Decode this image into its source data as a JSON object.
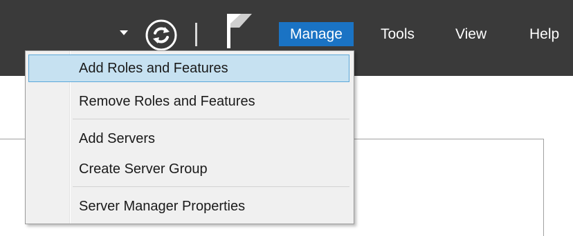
{
  "toolbar": {
    "icons": {
      "dropdown": "chevron-down-icon",
      "refresh": "refresh-icon",
      "notifications": "flag-icon"
    }
  },
  "menubar": {
    "manage": "Manage",
    "tools": "Tools",
    "view": "View",
    "help": "Help",
    "active_color": "#1a73c4"
  },
  "manage_menu": {
    "items": [
      {
        "label": "Add Roles and Features",
        "highlighted": true
      },
      {
        "label": "Remove Roles and Features"
      },
      {
        "label": "Add Servers"
      },
      {
        "label": "Create Server Group"
      },
      {
        "label": "Server Manager Properties"
      }
    ],
    "highlight_color": "#c6e1f1"
  }
}
